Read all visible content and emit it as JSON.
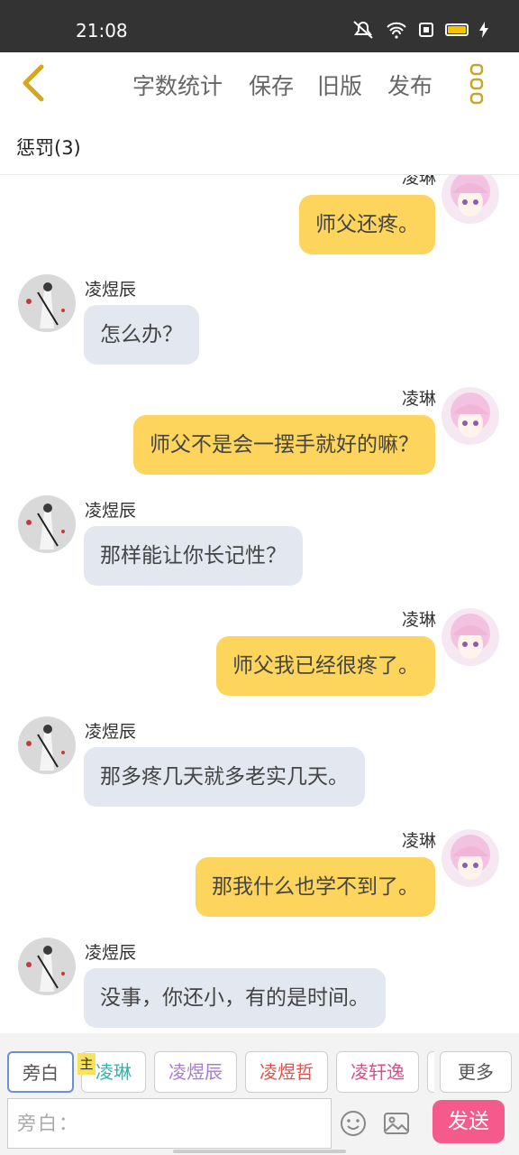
{
  "status_bar": {
    "time": "21:08"
  },
  "toolbar": {
    "word_count": "字数统计",
    "save": "保存",
    "old_version": "旧版",
    "publish": "发布"
  },
  "chapter_title": "惩罚(3)",
  "messages": [
    {
      "side": "right",
      "speaker": "凌琳",
      "text": "师父还疼。"
    },
    {
      "side": "left",
      "speaker": "凌煜辰",
      "text": "怎么办？"
    },
    {
      "side": "right",
      "speaker": "凌琳",
      "text": "师父不是会一摆手就好的嘛？"
    },
    {
      "side": "left",
      "speaker": "凌煜辰",
      "text": "那样能让你长记性？"
    },
    {
      "side": "right",
      "speaker": "凌琳",
      "text": "师父我已经很疼了。"
    },
    {
      "side": "left",
      "speaker": "凌煜辰",
      "text": "那多疼几天就多老实几天。"
    },
    {
      "side": "right",
      "speaker": "凌琳",
      "text": "那我什么也学不到了。"
    },
    {
      "side": "left",
      "speaker": "凌煜辰",
      "text": "没事，你还小，有的是时间。"
    }
  ],
  "characters": [
    {
      "label": "旁白",
      "color": "#666666"
    },
    {
      "label": "凌琳",
      "color": "#2fb5b0"
    },
    {
      "label": "凌煜辰",
      "color": "#a77bd6"
    },
    {
      "label": "凌煜哲",
      "color": "#e0524a"
    },
    {
      "label": "凌轩逸",
      "color": "#e14a8a"
    }
  ],
  "main_badge": "主",
  "more_label": "更多",
  "input": {
    "placeholder": "旁白："
  },
  "send_label": "发送",
  "colors": {
    "accent_yellow": "#fdd55c",
    "bubble_gray": "#e3e7ef",
    "send_pink": "#f45b8c"
  }
}
